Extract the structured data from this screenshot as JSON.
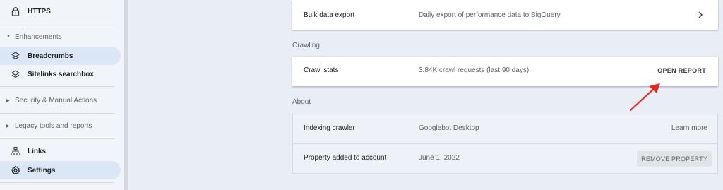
{
  "sidebar": {
    "https_label": "HTTPS",
    "enhancements_label": "Enhancements",
    "breadcrumbs_label": "Breadcrumbs",
    "sitelinks_label": "Sitelinks searchbox",
    "security_label": "Security & Manual Actions",
    "legacy_label": "Legacy tools and reports",
    "links_label": "Links",
    "settings_label": "Settings"
  },
  "main": {
    "bulk_export": {
      "name": "Bulk data export",
      "value": "Daily export of performance data to BigQuery"
    },
    "crawling_label": "Crawling",
    "crawl_stats": {
      "name": "Crawl stats",
      "value": "3.84K crawl requests (last 90 days)",
      "action": "OPEN REPORT"
    },
    "about_label": "About",
    "indexing_crawler": {
      "name": "Indexing crawler",
      "value": "Googlebot Desktop",
      "link": "Learn more"
    },
    "property_added": {
      "name": "Property added to account",
      "value": "June 1, 2022",
      "action": "REMOVE PROPERTY"
    }
  },
  "colors": {
    "annotation_arrow": "#e8261c",
    "active_nav": "#dbe6f6"
  }
}
